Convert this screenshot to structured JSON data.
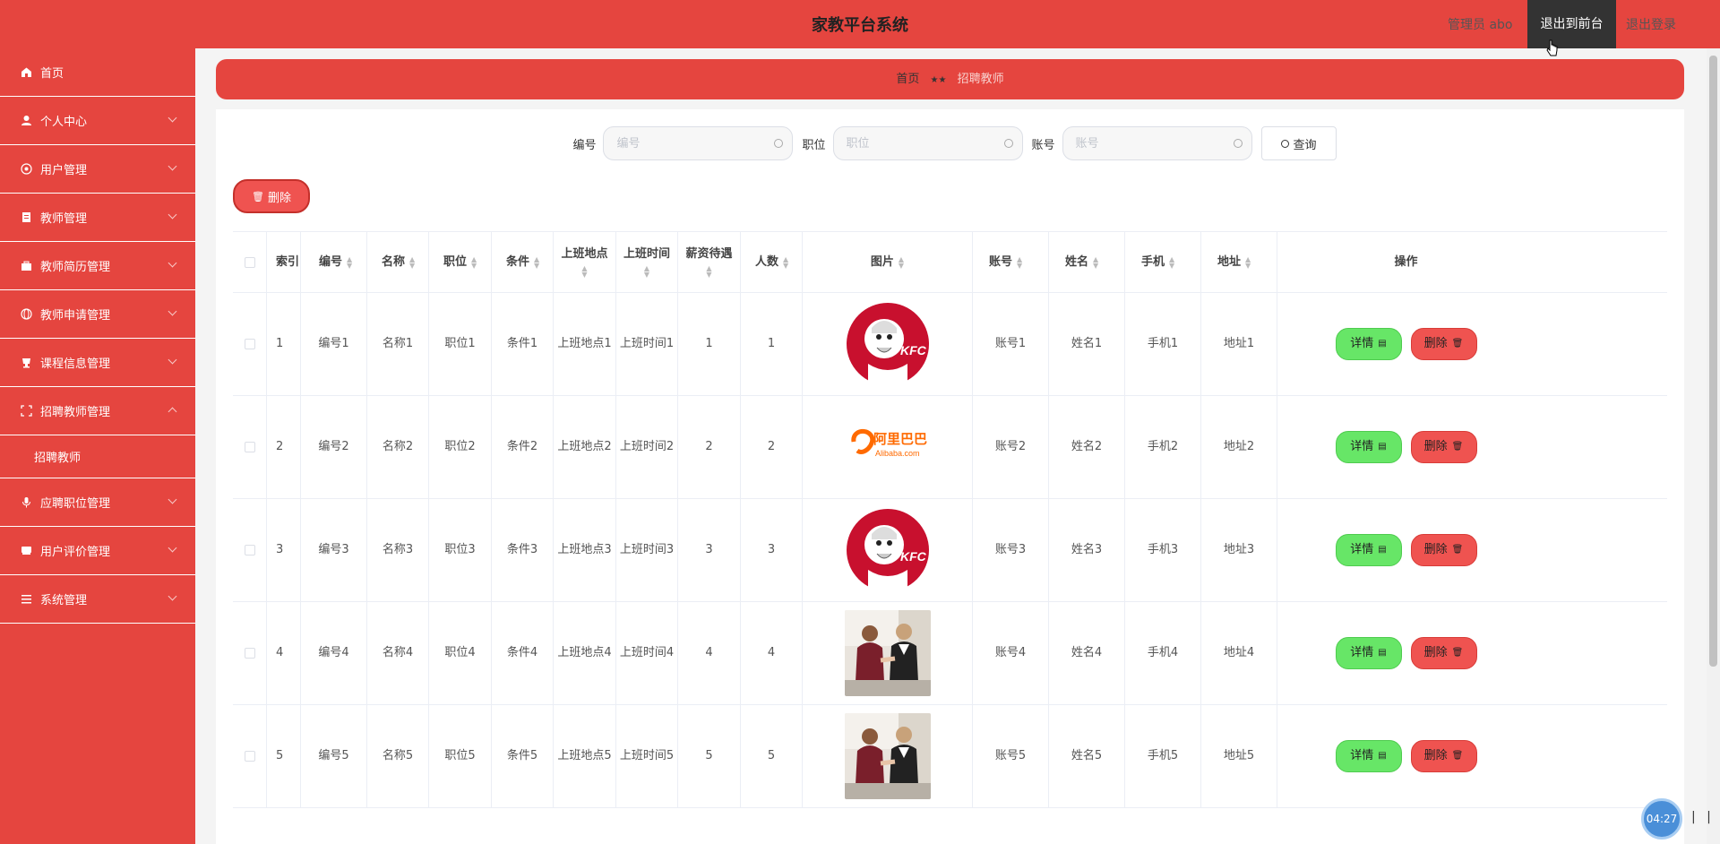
{
  "header": {
    "title": "家教平台系统",
    "admin_label": "管理员 abo",
    "front_label": "退出到前台",
    "logout_label": "退出登录"
  },
  "sidebar": {
    "items": [
      {
        "label": "首页",
        "icon": "home-icon",
        "has_arrow": false
      },
      {
        "label": "个人中心",
        "icon": "user-icon",
        "has_arrow": true
      },
      {
        "label": "用户管理",
        "icon": "users-icon",
        "has_arrow": true
      },
      {
        "label": "教师管理",
        "icon": "teacher-icon",
        "has_arrow": true
      },
      {
        "label": "教师简历管理",
        "icon": "briefcase-icon",
        "has_arrow": true
      },
      {
        "label": "教师申请管理",
        "icon": "globe-icon",
        "has_arrow": true
      },
      {
        "label": "课程信息管理",
        "icon": "cup-icon",
        "has_arrow": true
      },
      {
        "label": "招聘教师管理",
        "icon": "grid-icon",
        "has_arrow": true,
        "expanded": true
      },
      {
        "label": "应聘职位管理",
        "icon": "mic-icon",
        "has_arrow": true
      },
      {
        "label": "用户评价管理",
        "icon": "comment-icon",
        "has_arrow": true
      },
      {
        "label": "系统管理",
        "icon": "menu-icon",
        "has_arrow": true
      }
    ],
    "submenu_label": "招聘教师"
  },
  "breadcrumb": {
    "home": "首页",
    "separator": "★★",
    "current": "招聘教师"
  },
  "search": {
    "fields": [
      {
        "label": "编号",
        "placeholder": "编号"
      },
      {
        "label": "职位",
        "placeholder": "职位"
      },
      {
        "label": "账号",
        "placeholder": "账号"
      }
    ],
    "button_label": "查询"
  },
  "toolbar": {
    "delete_label": "删除"
  },
  "table": {
    "headers": [
      "索引",
      "编号",
      "名称",
      "职位",
      "条件",
      "上班地点",
      "上班时间",
      "薪资待遇",
      "人数",
      "图片",
      "账号",
      "姓名",
      "手机",
      "地址",
      "操作"
    ],
    "rows": [
      {
        "index": "1",
        "code": "编号1",
        "name": "名称1",
        "position": "职位1",
        "condition": "条件1",
        "location": "上班地点1",
        "time": "上班时间1",
        "salary": "1",
        "count": "1",
        "image": "kfc-logo",
        "account": "账号1",
        "realname": "姓名1",
        "phone": "手机1",
        "address": "地址1"
      },
      {
        "index": "2",
        "code": "编号2",
        "name": "名称2",
        "position": "职位2",
        "condition": "条件2",
        "location": "上班地点2",
        "time": "上班时间2",
        "salary": "2",
        "count": "2",
        "image": "alibaba-logo",
        "account": "账号2",
        "realname": "姓名2",
        "phone": "手机2",
        "address": "地址2"
      },
      {
        "index": "3",
        "code": "编号3",
        "name": "名称3",
        "position": "职位3",
        "condition": "条件3",
        "location": "上班地点3",
        "time": "上班时间3",
        "salary": "3",
        "count": "3",
        "image": "kfc-logo",
        "account": "账号3",
        "realname": "姓名3",
        "phone": "手机3",
        "address": "地址3"
      },
      {
        "index": "4",
        "code": "编号4",
        "name": "名称4",
        "position": "职位4",
        "condition": "条件4",
        "location": "上班地点4",
        "time": "上班时间4",
        "salary": "4",
        "count": "4",
        "image": "handshake-photo",
        "account": "账号4",
        "realname": "姓名4",
        "phone": "手机4",
        "address": "地址4"
      },
      {
        "index": "5",
        "code": "编号5",
        "name": "名称5",
        "position": "职位5",
        "condition": "条件5",
        "location": "上班地点5",
        "time": "上班时间5",
        "salary": "5",
        "count": "5",
        "image": "handshake-photo",
        "account": "账号5",
        "realname": "姓名5",
        "phone": "手机5",
        "address": "地址5"
      }
    ],
    "detail_label": "详情",
    "delete_label": "删除"
  },
  "widget": {
    "timer": "04:27",
    "bars": "| |"
  },
  "colors": {
    "primary": "#e5453f",
    "detail_button": "#67e667",
    "delete_button": "#ef5350"
  }
}
